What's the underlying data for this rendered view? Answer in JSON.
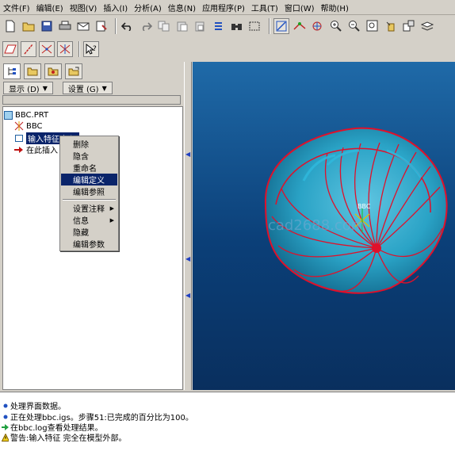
{
  "menubar": {
    "items": [
      "文件(F)",
      "编辑(E)",
      "视图(V)",
      "插入(I)",
      "分析(A)",
      "信息(N)",
      "应用程序(P)",
      "工具(T)",
      "窗口(W)",
      "帮助(H)"
    ]
  },
  "panel": {
    "display_menu": "显示 (D)",
    "settings_menu": "设置 (G)"
  },
  "tree": {
    "root": "BBC.PRT",
    "items": [
      "BBC",
      "输入特征 标识",
      "在此插入"
    ]
  },
  "context_menu": {
    "items": [
      "删除",
      "隐含",
      "重命名",
      "编辑定义",
      "编辑参照",
      "设置注释",
      "信息",
      "隐藏",
      "编辑参数"
    ],
    "highlighted": "编辑定义"
  },
  "viewport": {
    "watermark": "cad2688.com",
    "csys_label": "BBC"
  },
  "messages": [
    "处理界面数据。",
    "正在处理bbc.igs。步骤51:已完成的百分比为100。",
    "在bbc.log查看处理结果。",
    "警告:输入特征 完全在模型外部。"
  ],
  "colors": {
    "selection": "#0a246a",
    "viewport_top": "#1f6aa8",
    "viewport_bottom": "#092f5e",
    "model_fill": "#2aa3c6",
    "model_edges": "#e0102a"
  }
}
